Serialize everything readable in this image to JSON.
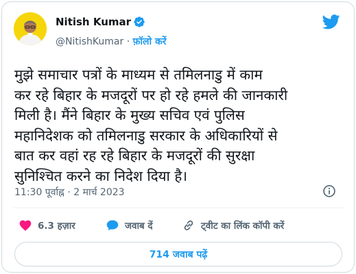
{
  "author": {
    "name": "Nitish Kumar",
    "handle": "@NitishKumar",
    "separator": "·",
    "follow_label": "फ़ॉलो करें",
    "verified": true
  },
  "tweet": {
    "lines": [
      "मुझे समाचार पत्रों के माध्यम से तमिलनाडु में काम",
      "कर रहे बिहार के मजदूरों पर हो रहे हमले की जानकारी",
      "मिली है। मैंने बिहार के मुख्य सचिव एवं पुलिस",
      "महानिदेशक को तमिलनाडु सरकार के अधिकारियों से",
      "बात कर वहां रह रहे बिहार के मजदूरों की सुरक्षा",
      "सुनिश्चित करने का निदेश दिया है।"
    ],
    "time": "11:30 पूर्वाह्न · 2 मार्च 2023"
  },
  "actions": {
    "likes": "6.3 हज़ार",
    "reply_label": "जवाब दें",
    "copy_link_label": "ट्वीट का लिंक कॉपी करें"
  },
  "replies_button_label": "714 जवाब पढ़ें",
  "icons": {
    "brand": "twitter-bird-icon",
    "verified": "verified-badge-icon",
    "info": "info-icon",
    "like": "heart-icon",
    "reply": "reply-bubble-icon",
    "link": "link-icon"
  },
  "colors": {
    "accent": "#1d9bf0",
    "like": "#f91880",
    "text": "#0f1419",
    "muted": "#536471",
    "avatar_bg": "#f5d60a"
  }
}
